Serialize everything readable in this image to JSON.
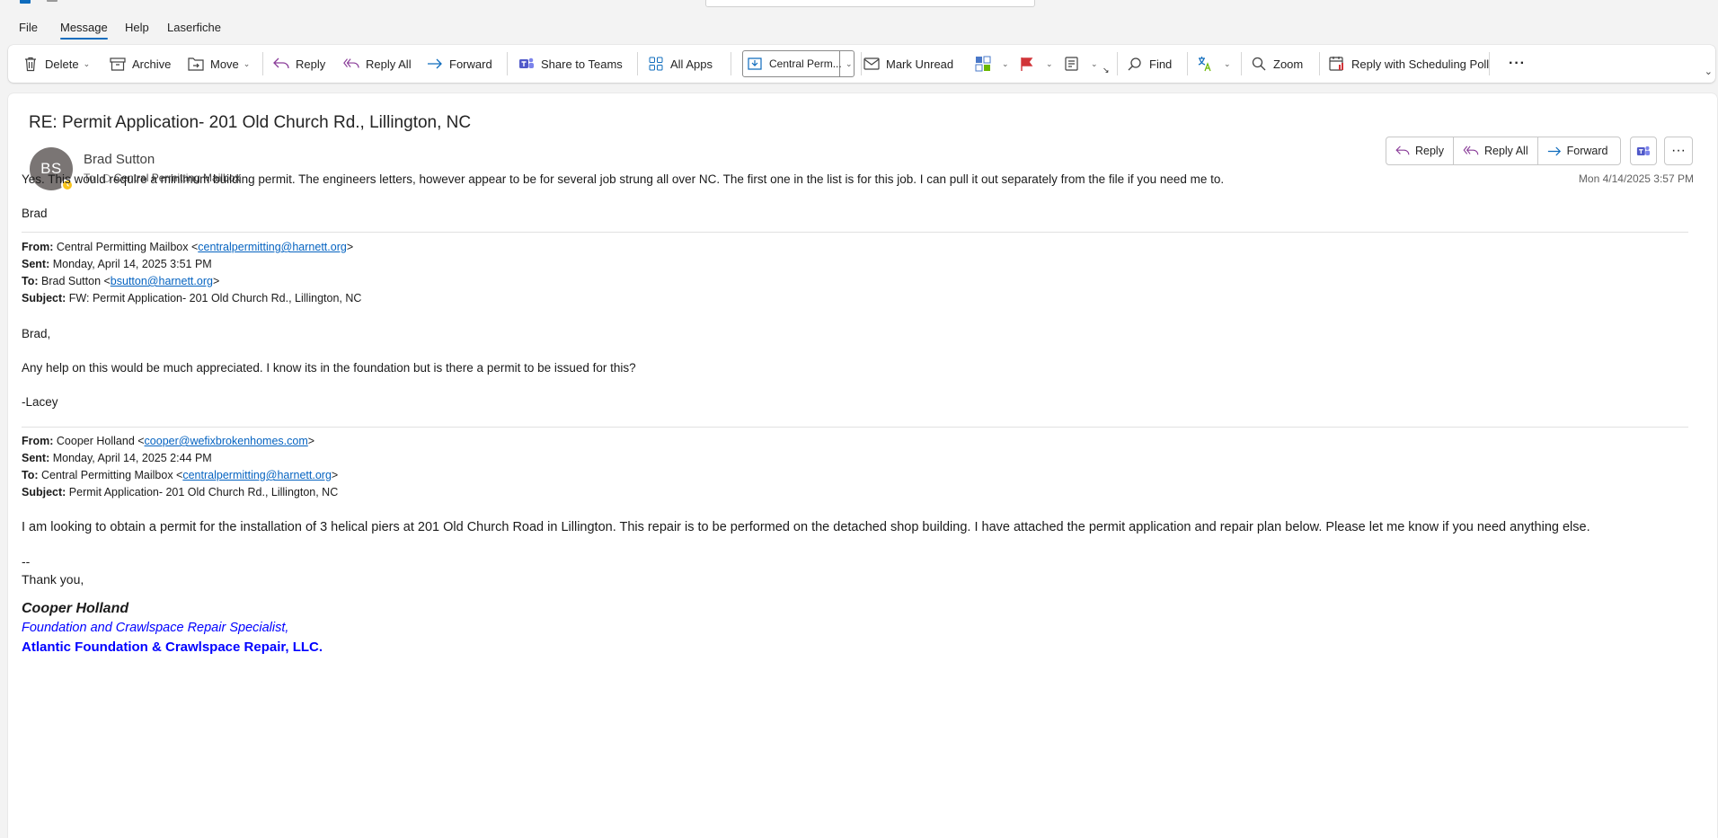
{
  "menu": {
    "tabs": [
      {
        "label": "File"
      },
      {
        "label": "Message"
      },
      {
        "label": "Help"
      },
      {
        "label": "Laserfiche"
      }
    ]
  },
  "ribbon": {
    "delete": "Delete",
    "archive": "Archive",
    "move": "Move",
    "reply": "Reply",
    "reply_all": "Reply All",
    "forward": "Forward",
    "share_teams": "Share to Teams",
    "all_apps": "All Apps",
    "quick_step": "Central Perm...",
    "mark_unread": "Mark Unread",
    "find": "Find",
    "zoom": "Zoom",
    "scheduling_poll": "Reply with Scheduling Poll",
    "more": "···"
  },
  "message": {
    "subject": "RE: Permit Application- 201 Old Church Rd., Lillington, NC",
    "avatar_initials": "BS",
    "sender": "Brad Sutton",
    "to_label": "To",
    "recipient": "Central Permitting Mailbox",
    "datetime": "Mon 4/14/2025 3:57 PM",
    "actions": {
      "reply": "Reply",
      "reply_all": "Reply All",
      "forward": "Forward",
      "more": "···"
    }
  },
  "body": {
    "reply_text": "Yes. This would require a minimum building permit. The engineers letters, however appear to be for several job strung all over NC. The first one in the list is for this job. I can pull it out separately from the file if you need me to.",
    "reply_sign": "Brad",
    "fw1": {
      "from_label": "From:",
      "from_name": "Central Permitting Mailbox <",
      "from_email": "centralpermitting@harnett.org",
      "sent_label": "Sent:",
      "sent": "Monday, April 14, 2025 3:51 PM",
      "to_label": "To:",
      "to_name": "Brad Sutton <",
      "to_email": "bsutton@harnett.org",
      "subject_label": "Subject:",
      "subject": "FW: Permit Application- 201 Old Church Rd., Lillington, NC",
      "greeting": "Brad,",
      "text": "Any help on this would be much appreciated.  I know its in the foundation but is there a permit to be issued for this?",
      "sign": "-Lacey"
    },
    "fw2": {
      "from_label": "From:",
      "from_name": "Cooper Holland <",
      "from_email": "cooper@wefixbrokenhomes.com",
      "sent_label": "Sent:",
      "sent": "Monday, April 14, 2025 2:44 PM",
      "to_label": "To:",
      "to_name": "Central Permitting Mailbox <",
      "to_email": "centralpermitting@harnett.org",
      "subject_label": "Subject:",
      "subject": "Permit Application- 201 Old Church Rd., Lillington, NC",
      "text": "I am looking to obtain a permit for the installation of 3 helical piers at 201 Old Church Road in Lillington. This repair is to be performed on the detached shop building. I have attached the permit application and repair plan below. Please let me know if you need anything else.",
      "dashes": "--",
      "thanks": "Thank you,",
      "sig_name": "Cooper Holland",
      "sig_title": "Foundation and Crawlspace Repair Specialist,",
      "sig_company": "Atlantic Foundation & Crawlspace Repair, LLC."
    }
  },
  "colors": {
    "accent": "#0f6cbd",
    "link": "#0563c1",
    "signature_blue": "#0000ff",
    "avatar": "#7a7574",
    "flag": "#d13438"
  }
}
